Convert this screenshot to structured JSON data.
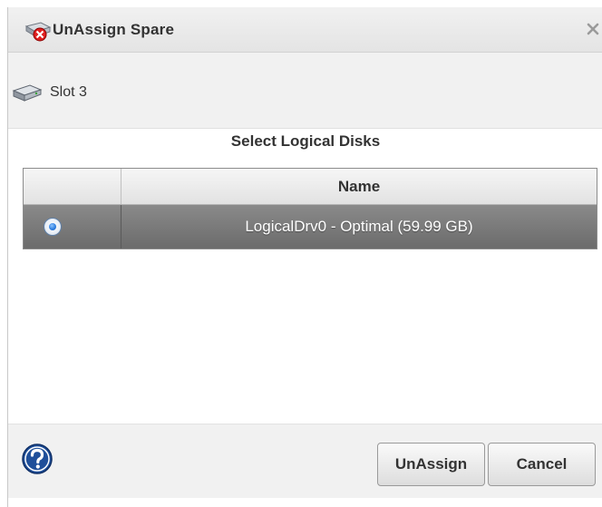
{
  "dialog": {
    "title": "UnAssign Spare",
    "title_icon": "drive-remove-icon",
    "close_icon": "close-icon"
  },
  "slot": {
    "label": "Slot 3",
    "icon": "hard-drive-icon"
  },
  "section": {
    "title": "Select Logical Disks"
  },
  "table": {
    "columns": [
      "",
      "Name"
    ],
    "rows": [
      {
        "name": "LogicalDrv0 - Optimal (59.99 GB)",
        "selected": true
      }
    ]
  },
  "footer": {
    "help_icon": "help-icon",
    "unassign_label": "UnAssign",
    "cancel_label": "Cancel"
  },
  "colors": {
    "selected_row": "#7a7a7a",
    "radio_accent": "#2f7fe0",
    "help_blue": "#1f4f9a"
  }
}
